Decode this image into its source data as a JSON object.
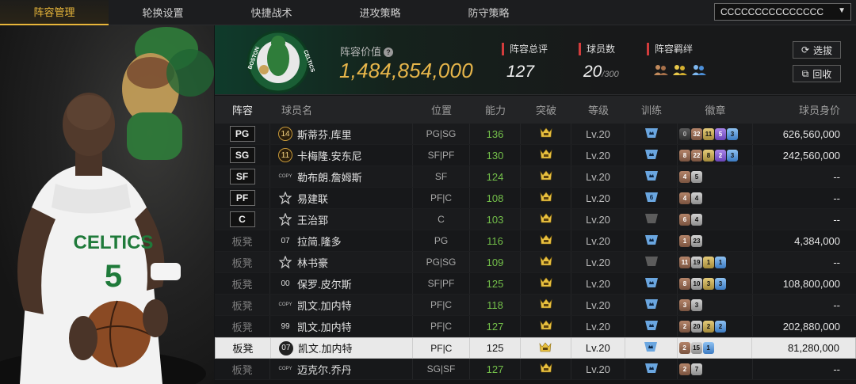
{
  "nav": {
    "tabs": [
      "阵容管理",
      "轮换设置",
      "快捷战术",
      "进攻策略",
      "防守策略"
    ],
    "active_tab": 0,
    "account": "CCCCCCCCCCCCCCC"
  },
  "header": {
    "lineup_value_label": "阵容价值",
    "lineup_value": "1,484,854,000",
    "overall_label": "阵容总评",
    "overall_value": "127",
    "players_label": "球员数",
    "players_count": "20",
    "players_max": "/300",
    "bond_label": "阵容羁绊",
    "btn_select": "选拔",
    "btn_recycle": "回收",
    "accent": "#e6b54a"
  },
  "table": {
    "headers": [
      "阵容",
      "球员名",
      "位置",
      "能力",
      "突破",
      "等级",
      "训练",
      "徽章",
      "球员身价"
    ],
    "rows": [
      {
        "role": "PG",
        "jersey": "14",
        "name": "斯蒂芬.库里",
        "pos": "PG|SG",
        "ability": "136",
        "level": "Lv.20",
        "train": "blue",
        "value": "626,560,000",
        "badges": [
          [
            "b-dark",
            "0"
          ],
          [
            "b-bronze",
            "32"
          ],
          [
            "b-gold",
            "11"
          ],
          [
            "b-purple",
            "5"
          ],
          [
            "b-blue",
            "3"
          ]
        ]
      },
      {
        "role": "SG",
        "jersey": "11",
        "name": "卡梅隆.安东尼",
        "pos": "SF|PF",
        "ability": "130",
        "level": "Lv.20",
        "train": "blue",
        "value": "242,560,000",
        "badges": [
          [
            "b-bronze",
            "8"
          ],
          [
            "b-bronze",
            "22"
          ],
          [
            "b-gold",
            "8"
          ],
          [
            "b-purple",
            "2"
          ],
          [
            "b-blue",
            "3"
          ]
        ]
      },
      {
        "role": "SF",
        "jersey": "COPY",
        "name": "勒布朗.詹姆斯",
        "pos": "SF",
        "ability": "124",
        "level": "Lv.20",
        "train": "blue",
        "value": "--",
        "badges": [
          [
            "b-bronze",
            "4"
          ],
          [
            "b-gray",
            "5"
          ]
        ]
      },
      {
        "role": "PF",
        "jersey": "☆",
        "name": "易建联",
        "pos": "PF|C",
        "ability": "108",
        "level": "Lv.20",
        "train": "blue6",
        "value": "--",
        "badges": [
          [
            "b-bronze",
            "4"
          ],
          [
            "b-gray",
            "4"
          ]
        ]
      },
      {
        "role": "C",
        "jersey": "☆",
        "name": "王治郅",
        "pos": "C",
        "ability": "103",
        "level": "Lv.20",
        "train": "gray",
        "value": "--",
        "badges": [
          [
            "b-bronze",
            "6"
          ],
          [
            "b-gray",
            "4"
          ]
        ]
      },
      {
        "role": "板凳",
        "jersey": "07",
        "name": "拉简.隆多",
        "pos": "PG",
        "ability": "116",
        "level": "Lv.20",
        "train": "blue",
        "value": "4,384,000",
        "badges": [
          [
            "b-bronze",
            "1"
          ],
          [
            "b-gray",
            "23"
          ]
        ]
      },
      {
        "role": "板凳",
        "jersey": "☆",
        "name": "林书豪",
        "pos": "PG|SG",
        "ability": "109",
        "level": "Lv.20",
        "train": "gray",
        "value": "--",
        "badges": [
          [
            "b-bronze",
            "11"
          ],
          [
            "b-gray",
            "19"
          ],
          [
            "b-gold",
            "1"
          ],
          [
            "b-blue",
            "1"
          ]
        ]
      },
      {
        "role": "板凳",
        "jersey": "00",
        "name": "保罗.皮尔斯",
        "pos": "SF|PF",
        "ability": "125",
        "level": "Lv.20",
        "train": "blue",
        "value": "108,800,000",
        "badges": [
          [
            "b-bronze",
            "8"
          ],
          [
            "b-gray",
            "10"
          ],
          [
            "b-gold",
            "3"
          ],
          [
            "b-blue",
            "3"
          ]
        ]
      },
      {
        "role": "板凳",
        "jersey": "COPY",
        "name": "凯文.加内特",
        "pos": "PF|C",
        "ability": "118",
        "level": "Lv.20",
        "train": "blue",
        "value": "--",
        "badges": [
          [
            "b-bronze",
            "3"
          ],
          [
            "b-gray",
            "3"
          ]
        ]
      },
      {
        "role": "板凳",
        "jersey": "99",
        "name": "凯文.加内特",
        "pos": "PF|C",
        "ability": "127",
        "level": "Lv.20",
        "train": "blue",
        "value": "202,880,000",
        "badges": [
          [
            "b-bronze",
            "2"
          ],
          [
            "b-gray",
            "20"
          ],
          [
            "b-gold",
            "2"
          ],
          [
            "b-blue",
            "2"
          ]
        ]
      },
      {
        "role": "板凳",
        "jersey": "07",
        "name": "凯文.加内特",
        "pos": "PF|C",
        "ability": "125",
        "level": "Lv.20",
        "train": "blue",
        "value": "81,280,000",
        "selected": true,
        "badges": [
          [
            "b-bronze",
            "2"
          ],
          [
            "b-gray",
            "15"
          ],
          [
            "b-blue",
            "1"
          ]
        ]
      },
      {
        "role": "板凳",
        "jersey": "COPY",
        "name": "迈克尔.乔丹",
        "pos": "SG|SF",
        "ability": "127",
        "level": "Lv.20",
        "train": "blue",
        "value": "--",
        "badges": [
          [
            "b-bronze",
            "2"
          ],
          [
            "b-gray",
            "7"
          ]
        ]
      }
    ]
  },
  "player_art": {
    "jersey_text": "CELTICS",
    "jersey_number": "5"
  },
  "logo": {
    "text_left": "BOSTON",
    "text_right": "CELTICS"
  }
}
